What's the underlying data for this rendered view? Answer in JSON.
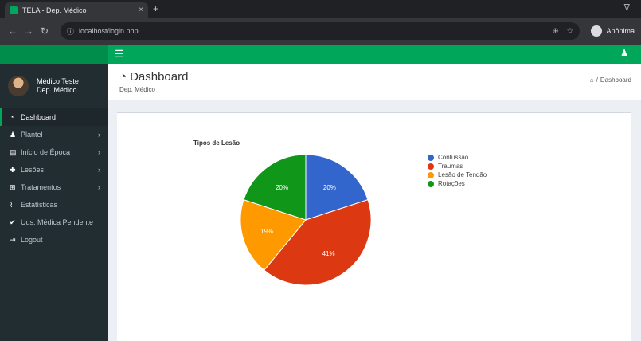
{
  "browser": {
    "tab_title": "TELA - Dep. Médico",
    "tab_close": "×",
    "new_tab": "+",
    "minimize": "ᐁ",
    "url": "localhost/login.php",
    "profile_name": "Anônima"
  },
  "header": {
    "menu_icon": "☰",
    "user_icon": "♟"
  },
  "sidebar": {
    "user_name_line1": "Médico Teste",
    "user_name_line2": "Dep. Médico",
    "items": [
      {
        "label": "Dashboard",
        "icon": "tachometer-icon",
        "glyph": "◔",
        "has_submenu": false,
        "active": true
      },
      {
        "label": "Plantel",
        "icon": "users-icon",
        "glyph": "♟",
        "has_submenu": true,
        "active": false
      },
      {
        "label": "Início de Época",
        "icon": "calendar-icon",
        "glyph": "▤",
        "has_submenu": true,
        "active": false
      },
      {
        "label": "Lesões",
        "icon": "medkit-icon",
        "glyph": "✚",
        "has_submenu": true,
        "active": false
      },
      {
        "label": "Tratamentos",
        "icon": "plus-square-icon",
        "glyph": "⊞",
        "has_submenu": true,
        "active": false
      },
      {
        "label": "Estatísticas",
        "icon": "chart-icon",
        "glyph": "⌇",
        "has_submenu": false,
        "active": false
      },
      {
        "label": "Uds. Médica Pendente",
        "icon": "check-icon",
        "glyph": "✔",
        "has_submenu": false,
        "active": false
      },
      {
        "label": "Logout",
        "icon": "sign-out-icon",
        "glyph": "⇥",
        "has_submenu": false,
        "active": false
      }
    ],
    "chevron": "›"
  },
  "content": {
    "title": "Dashboard",
    "subtitle": "Dep. Médico",
    "breadcrumb_home": "⌂",
    "breadcrumb_sep": "/",
    "breadcrumb_current": "Dashboard"
  },
  "chart_data": {
    "type": "pie",
    "title": "Tipos de Lesão",
    "slices": [
      {
        "label": "Contussão",
        "value": 20,
        "display": "20%",
        "color": "#3366cc"
      },
      {
        "label": "Traumas",
        "value": 41,
        "display": "41%",
        "color": "#dc3912"
      },
      {
        "label": "Lesão de Tendão",
        "value": 19,
        "display": "19%",
        "color": "#ff9900"
      },
      {
        "label": "Rotações",
        "value": 20,
        "display": "20%",
        "color": "#109618"
      }
    ],
    "legend_position": "right"
  }
}
